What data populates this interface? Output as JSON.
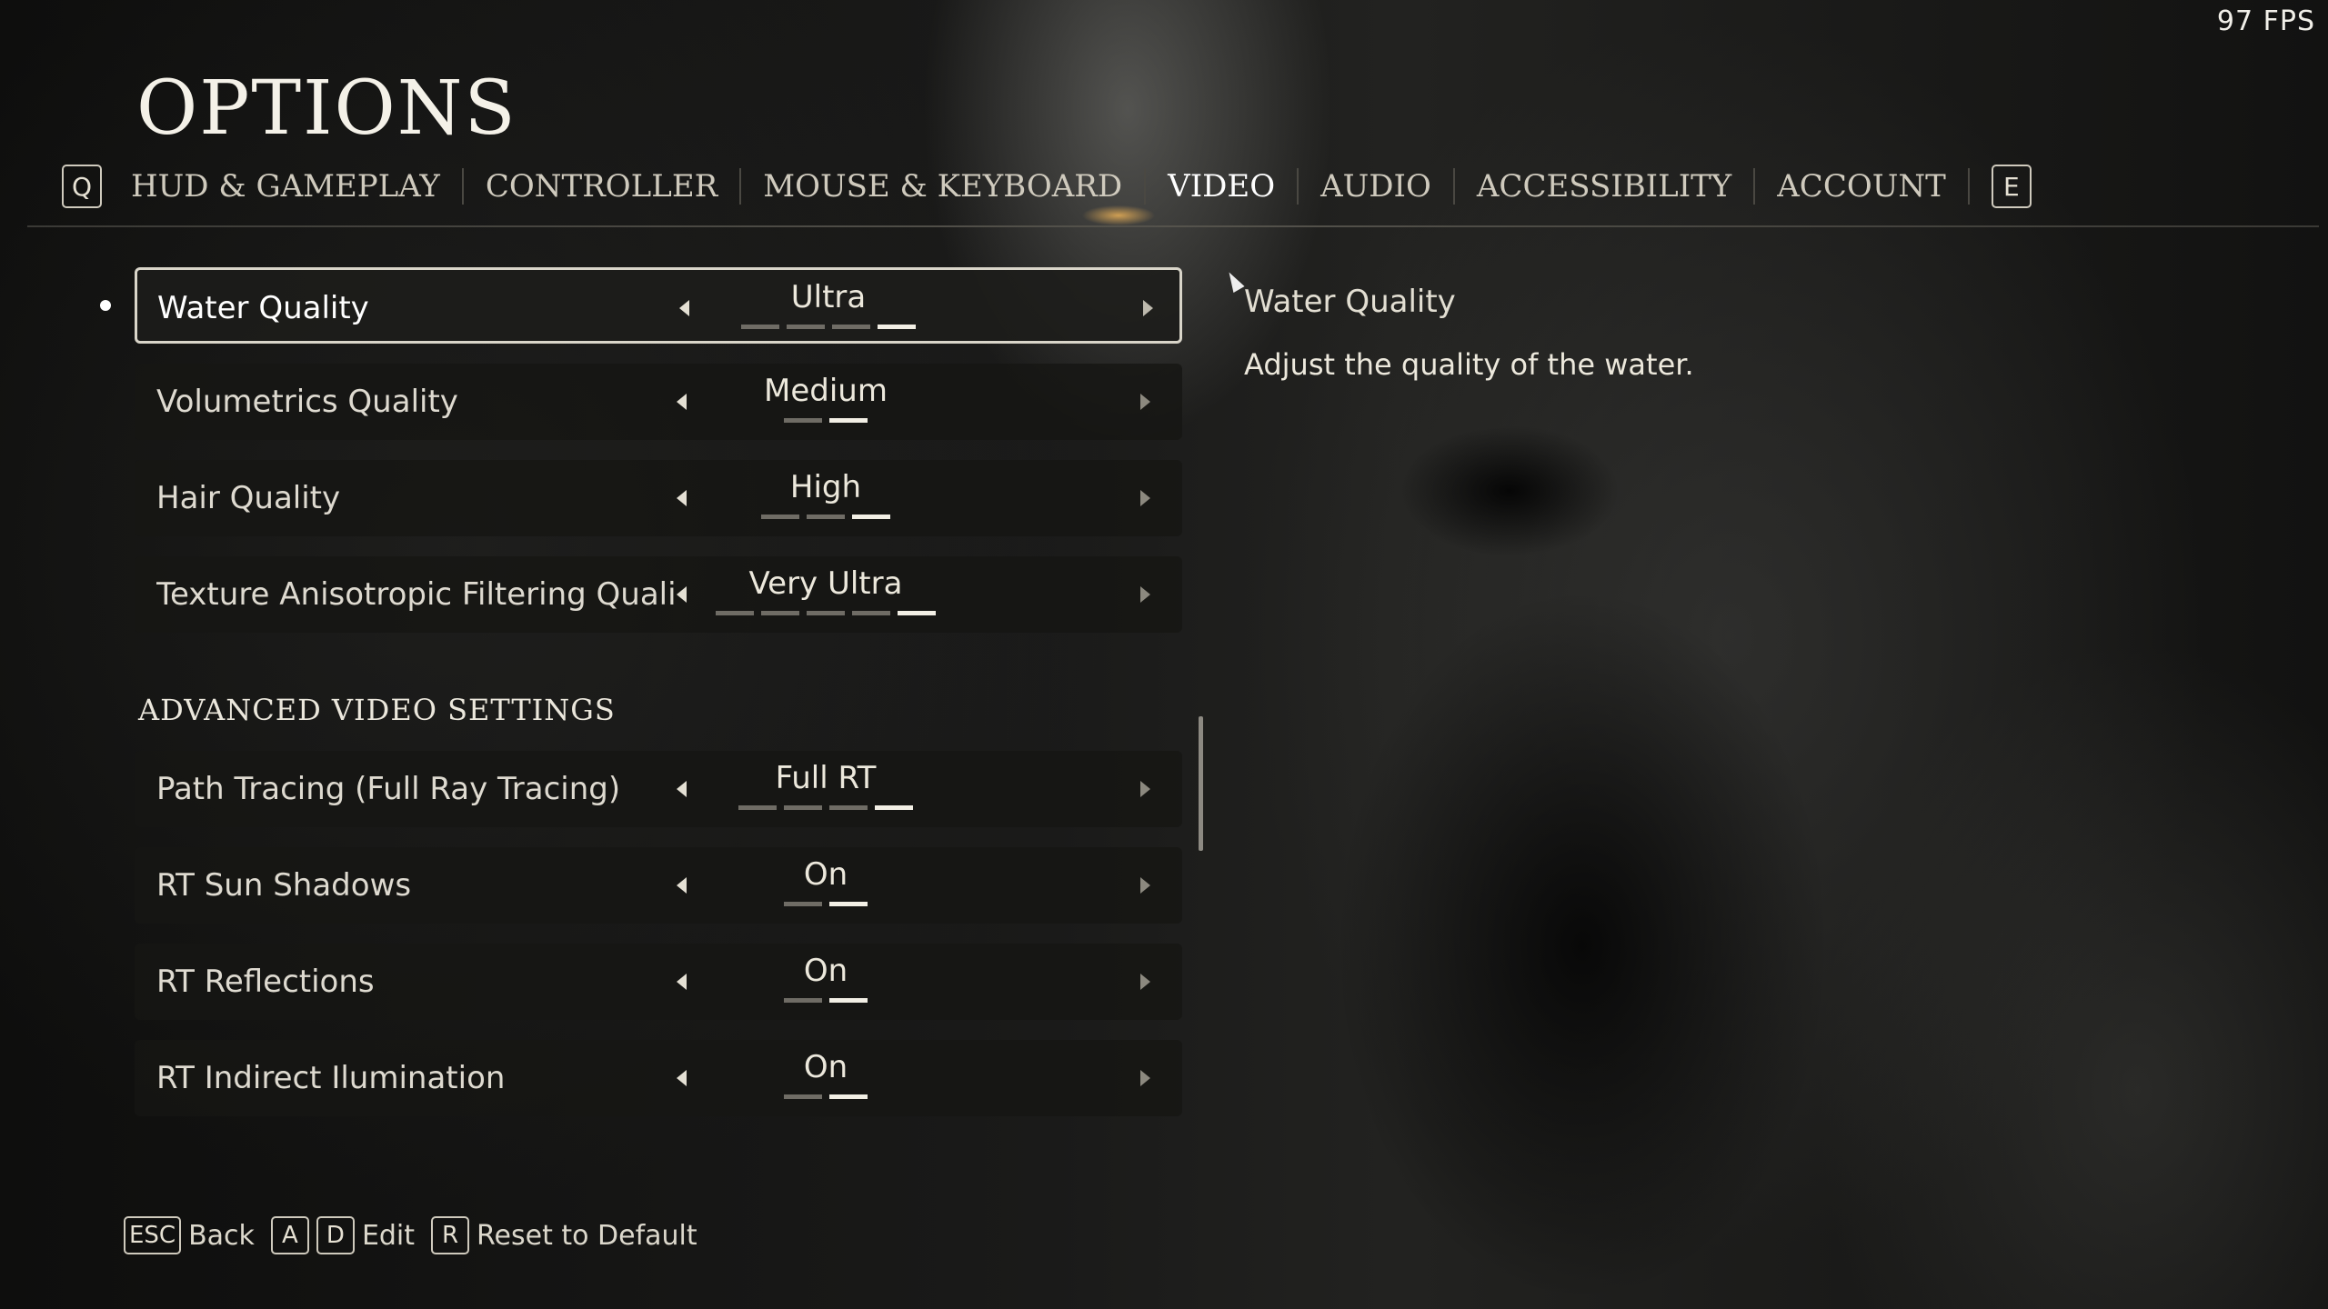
{
  "fps": "97  FPS",
  "title": "OPTIONS",
  "tabs": {
    "prev_key": "Q",
    "next_key": "E",
    "items": [
      {
        "label": "HUD & GAMEPLAY"
      },
      {
        "label": "CONTROLLER"
      },
      {
        "label": "MOUSE & KEYBOARD"
      },
      {
        "label": "VIDEO"
      },
      {
        "label": "AUDIO"
      },
      {
        "label": "ACCESSIBILITY"
      },
      {
        "label": "ACCOUNT"
      }
    ],
    "active": "VIDEO"
  },
  "settings": [
    {
      "label": "Water Quality",
      "value": "Ultra",
      "level": 4,
      "steps": 4,
      "selected": true
    },
    {
      "label": "Volumetrics Quality",
      "value": "Medium",
      "level": 2,
      "steps": 2
    },
    {
      "label": "Hair Quality",
      "value": "High",
      "level": 3,
      "steps": 3
    },
    {
      "label": "Texture Anisotropic Filtering Quali",
      "value": "Very Ultra",
      "level": 5,
      "steps": 5
    }
  ],
  "advanced": {
    "heading": "ADVANCED VIDEO SETTINGS",
    "settings": [
      {
        "label": "Path Tracing (Full Ray Tracing)",
        "value": "Full RT",
        "level": 4,
        "steps": 4
      },
      {
        "label": "RT Sun Shadows",
        "value": "On",
        "level": 2,
        "steps": 2
      },
      {
        "label": "RT Reflections",
        "value": "On",
        "level": 2,
        "steps": 2
      },
      {
        "label": "RT Indirect Ilumination",
        "value": "On",
        "level": 2,
        "steps": 2
      }
    ]
  },
  "description": {
    "title": "Water Quality",
    "text": "Adjust the quality of the water."
  },
  "footer": {
    "back_key": "ESC",
    "back_label": "Back",
    "edit_key_a": "A",
    "edit_key_d": "D",
    "edit_label": "Edit",
    "reset_key": "R",
    "reset_label": "Reset to Default"
  },
  "colors": {
    "text": "#e9e4d6",
    "highlight": "#ffffff",
    "accent_glow": "#ffbe5a"
  }
}
